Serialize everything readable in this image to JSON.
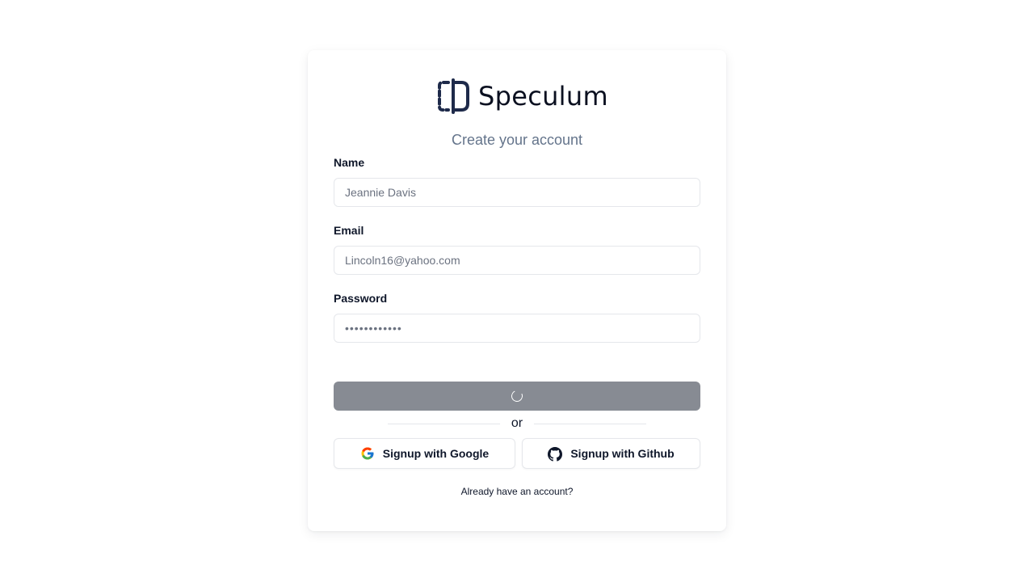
{
  "brand": {
    "name": "Speculum",
    "logo_color": "#1e2a4a"
  },
  "form": {
    "subtitle": "Create your account",
    "name_label": "Name",
    "name_placeholder": "Jeannie Davis",
    "email_label": "Email",
    "email_placeholder": "Lincoln16@yahoo.com",
    "password_label": "Password",
    "password_placeholder": "••••••••••••",
    "submit_state": "loading",
    "submit_color": "#878b93"
  },
  "divider_text": "or",
  "oauth": {
    "google_label": "Signup with Google",
    "github_label": "Signup with Github",
    "google_icon": "google-icon",
    "github_icon": "github-icon"
  },
  "footer": {
    "signin_link": "Already have an account?"
  }
}
